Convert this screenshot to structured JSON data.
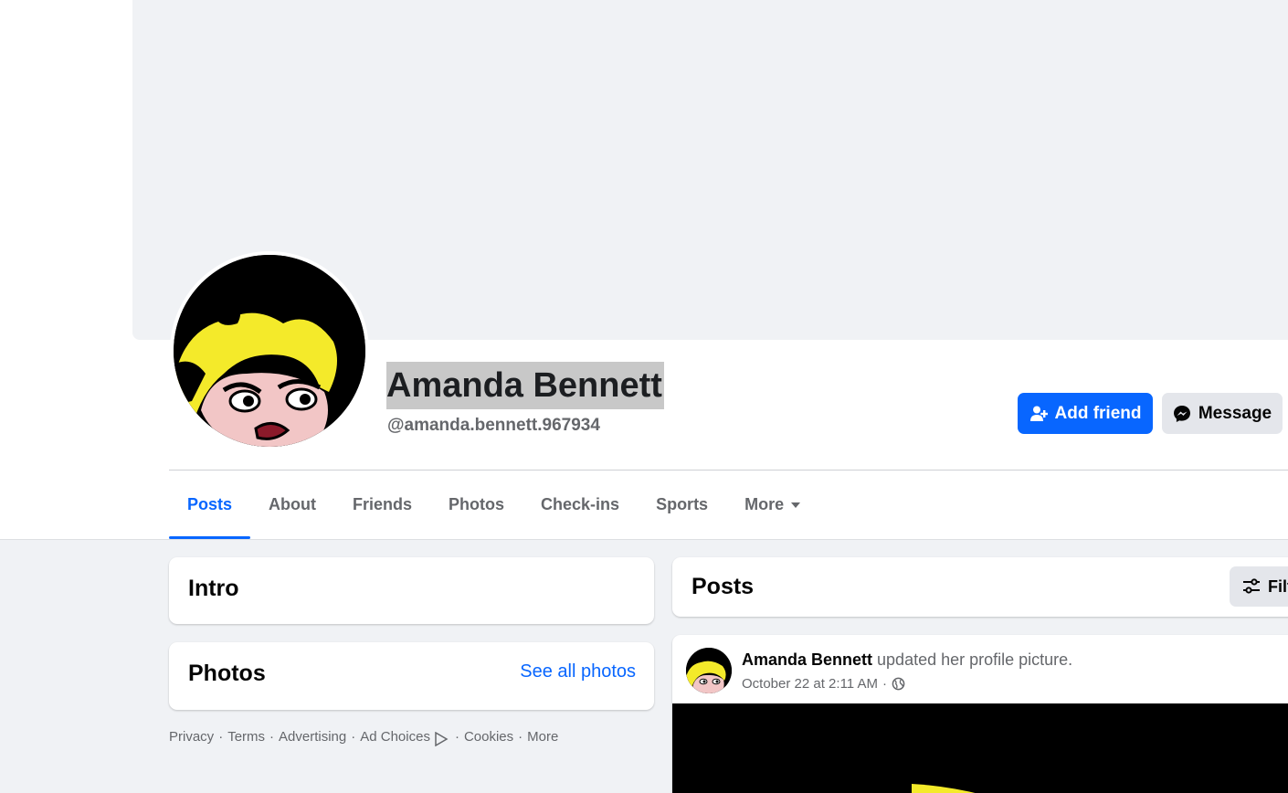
{
  "profile": {
    "name": "Amanda Bennett",
    "handle": "@amanda.bennett.967934"
  },
  "actions": {
    "add_friend": "Add friend",
    "message": "Message"
  },
  "tabs": [
    {
      "label": "Posts",
      "active": true
    },
    {
      "label": "About"
    },
    {
      "label": "Friends"
    },
    {
      "label": "Photos"
    },
    {
      "label": "Check-ins"
    },
    {
      "label": "Sports"
    },
    {
      "label": "More"
    }
  ],
  "intro": {
    "title": "Intro"
  },
  "photos": {
    "title": "Photos",
    "see_all": "See all photos"
  },
  "footer": {
    "links": [
      "Privacy",
      "Terms",
      "Advertising",
      "Ad Choices",
      "Cookies",
      "More"
    ]
  },
  "posts": {
    "title": "Posts",
    "filter_label": "Filt",
    "items": [
      {
        "author": "Amanda Bennett",
        "action": "updated her profile picture.",
        "time": "October 22 at 2:11 AM"
      }
    ]
  },
  "colors": {
    "accent": "#0866ff",
    "secondary_button": "#e4e6eb",
    "muted_text": "#65676b",
    "page_bg": "#f0f2f5"
  }
}
